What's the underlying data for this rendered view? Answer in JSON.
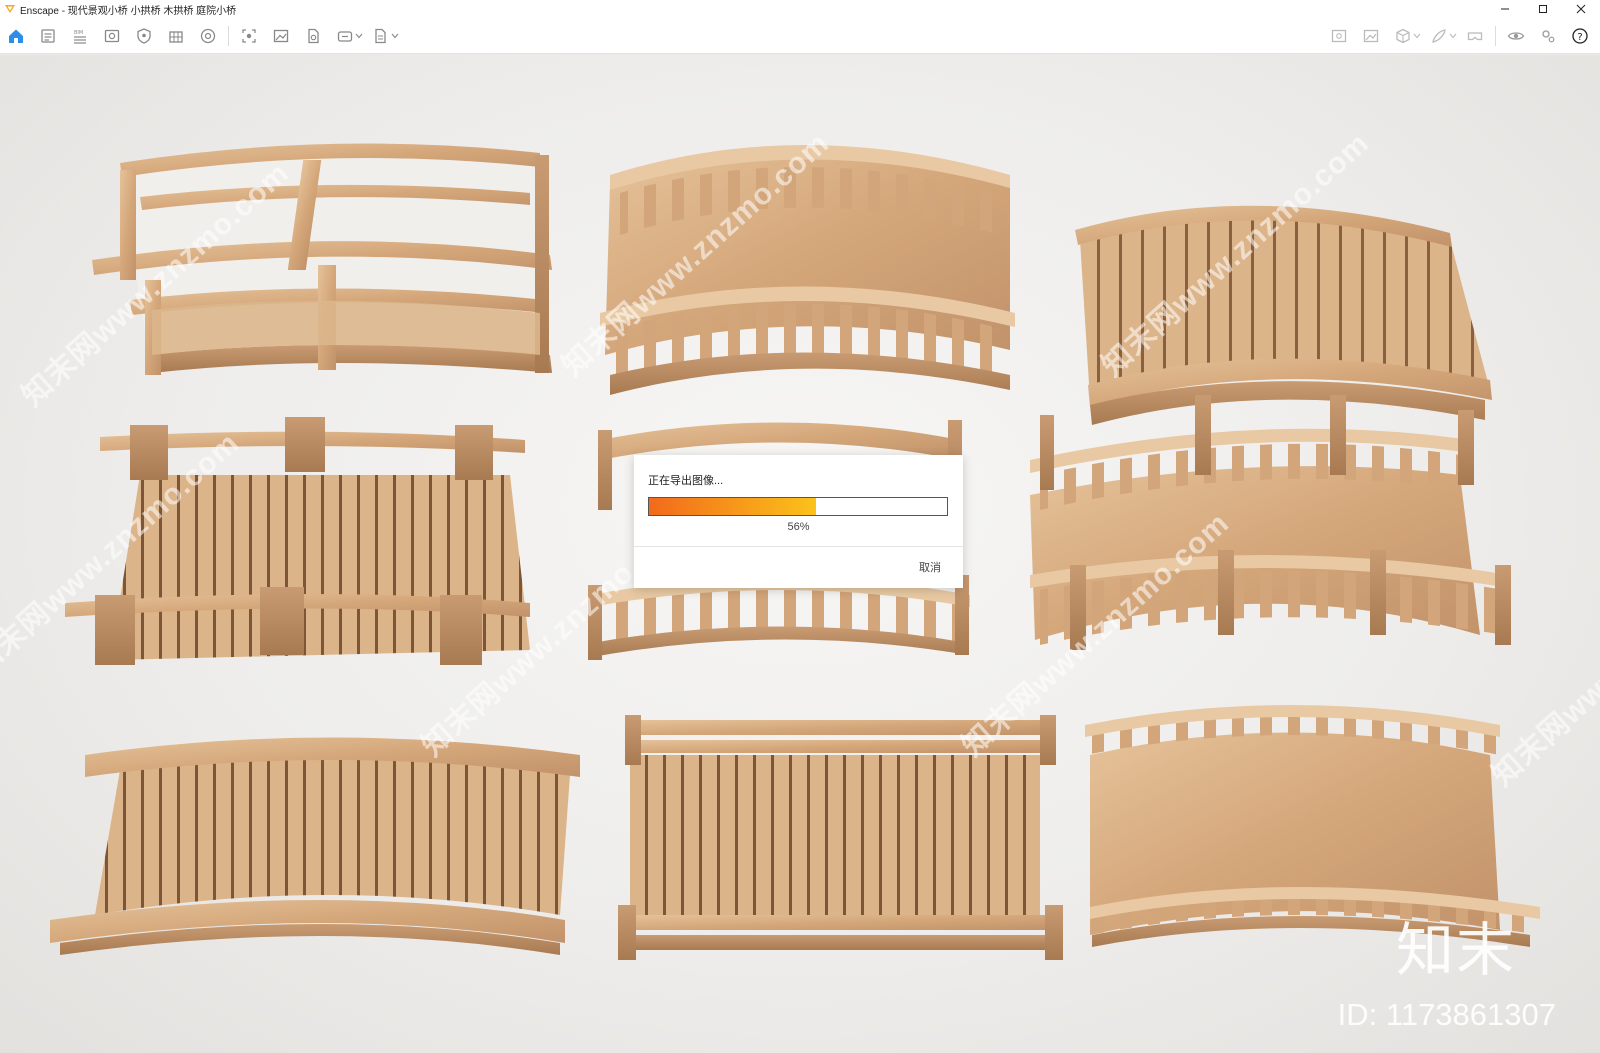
{
  "window": {
    "title": "Enscape - 现代景观小桥 小拱桥 木拱桥 庭院小桥",
    "accent_color": "#1e90ff"
  },
  "toolbar": {
    "left_icons": [
      "home-icon",
      "assets-icon",
      "bim-icon",
      "views-icon",
      "atmosphere-icon",
      "building-icon",
      "materials-icon",
      "capture-icon",
      "screenshot-icon",
      "render-export-icon",
      "panorama-icon",
      "batch-export-icon"
    ],
    "right_icons": [
      "image-settings-icon",
      "gallery-icon",
      "object-icon",
      "paint-icon",
      "vr-icon",
      "visibility-icon",
      "settings-icon",
      "help-icon"
    ]
  },
  "viewport": {
    "watermark_text": "知末网www.znzmo.com",
    "brand_text": "知末",
    "id_text": "ID: 1173861307"
  },
  "export_dialog": {
    "title": "正在导出图像...",
    "progress_percent": 56,
    "progress_label": "56%",
    "cancel_label": "取消",
    "progress_colors": [
      "#f26a1b",
      "#fbc21a"
    ]
  }
}
